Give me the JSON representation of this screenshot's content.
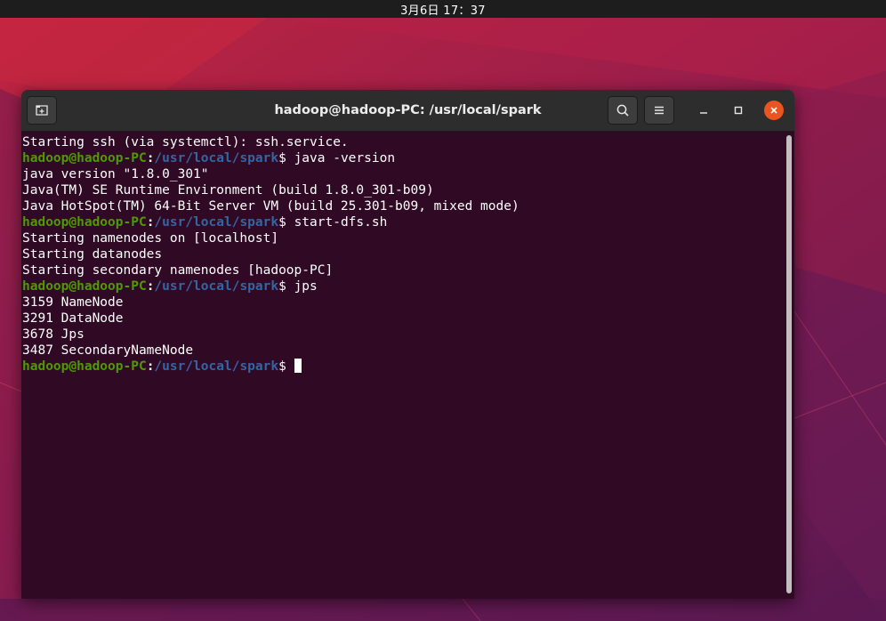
{
  "topbar": {
    "clock": "3月6日  17：37"
  },
  "window": {
    "title": "hadoop@hadoop-PC: /usr/local/spark",
    "buttons": {
      "new_tab_icon": "new-tab-icon",
      "search_icon": "search-icon",
      "menu_icon": "hamburger-menu-icon",
      "minimize_icon": "minimize-icon",
      "maximize_icon": "maximize-icon",
      "close_icon": "close-icon"
    },
    "accent_close": "#e95420"
  },
  "terminal": {
    "prompt": {
      "user": "hadoop@hadoop-PC",
      "sep": ":",
      "path": "/usr/local/spark",
      "dollar": "$ "
    },
    "colors": {
      "background": "#300a24",
      "user": "#4e9a06",
      "path": "#3465a4",
      "text": "#ffffff"
    },
    "lines": [
      {
        "type": "output",
        "text": "Starting ssh (via systemctl): ssh.service."
      },
      {
        "type": "prompt",
        "cmd": "java -version"
      },
      {
        "type": "output",
        "text": "java version \"1.8.0_301\""
      },
      {
        "type": "output",
        "text": "Java(TM) SE Runtime Environment (build 1.8.0_301-b09)"
      },
      {
        "type": "output",
        "text": "Java HotSpot(TM) 64-Bit Server VM (build 25.301-b09, mixed mode)"
      },
      {
        "type": "prompt",
        "cmd": "start-dfs.sh"
      },
      {
        "type": "output",
        "text": "Starting namenodes on [localhost]"
      },
      {
        "type": "output",
        "text": "Starting datanodes"
      },
      {
        "type": "output",
        "text": "Starting secondary namenodes [hadoop-PC]"
      },
      {
        "type": "prompt",
        "cmd": "jps"
      },
      {
        "type": "output",
        "text": "3159 NameNode"
      },
      {
        "type": "output",
        "text": "3291 DataNode"
      },
      {
        "type": "output",
        "text": "3678 Jps"
      },
      {
        "type": "output",
        "text": "3487 SecondaryNameNode"
      },
      {
        "type": "prompt",
        "cmd": "",
        "cursor": true
      }
    ]
  }
}
